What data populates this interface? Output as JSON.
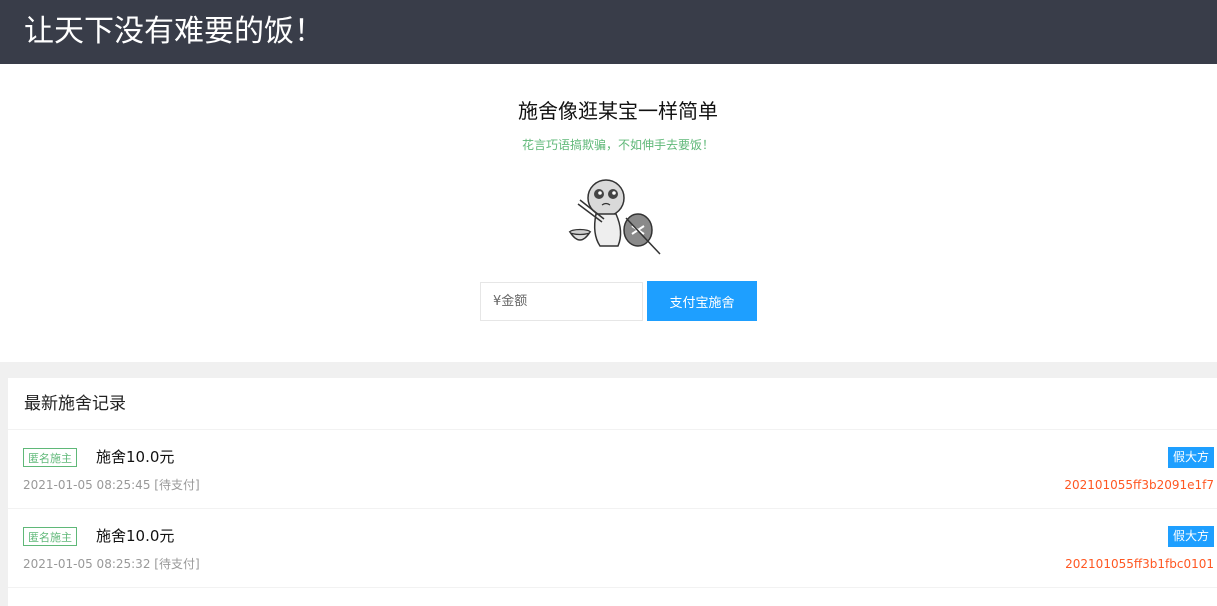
{
  "header": {
    "title": "让天下没有难要的饭！"
  },
  "hero": {
    "title": "施舍像逛某宝一样简单",
    "subtitle": "花言巧语搞欺骗，不如伸手去要饭！",
    "mascot_icon": "begging-mascot-icon",
    "amount_placeholder": "¥金额",
    "amount_value": "",
    "pay_button_label": "支付宝施舍"
  },
  "records": {
    "heading": "最新施舍记录",
    "items": [
      {
        "tag": "匿名施主",
        "title": "施舍10.0元",
        "time": "2021-01-05 08:25:45",
        "status": "[待支付]",
        "badge": "假大方",
        "order_id": "202101055ff3b2091e1f7"
      },
      {
        "tag": "匿名施主",
        "title": "施舍10.0元",
        "time": "2021-01-05 08:25:32",
        "status": "[待支付]",
        "badge": "假大方",
        "order_id": "202101055ff3b1fbc0101"
      }
    ]
  },
  "colors": {
    "header_bg": "#393d49",
    "accent_blue": "#1e9fff",
    "accent_green": "#5fb878",
    "order_red": "#ff5722"
  }
}
